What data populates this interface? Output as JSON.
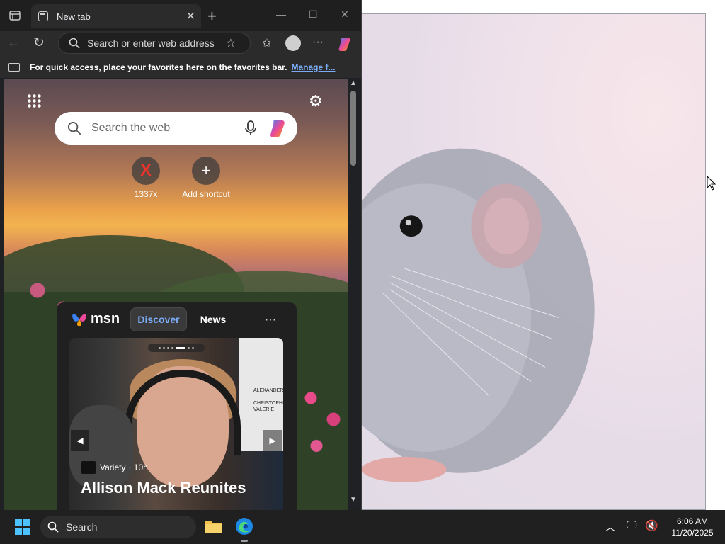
{
  "browser": {
    "tab_title": "New tab",
    "address_placeholder": "Search or enter web address",
    "favorites_message": "For quick access, place your favorites here on the favorites bar.",
    "favorites_link": "Manage f...",
    "more_label": "···"
  },
  "ntp": {
    "search_placeholder": "Search the web",
    "shortcuts": [
      {
        "label": "1337x"
      },
      {
        "label": "Add shortcut"
      }
    ]
  },
  "msn": {
    "brand": "msn",
    "tabs": [
      "Discover",
      "News"
    ],
    "more": "···",
    "article": {
      "source": "Variety",
      "age": "· 10h",
      "headline": "Allison Mack Reunites"
    }
  },
  "taskbar": {
    "search_label": "Search",
    "time": "6:06 AM",
    "date": "11/20/2025"
  },
  "colors": {
    "accent": "#7cacf8",
    "copilot_gradient": [
      "#3b82f6",
      "#ec4899",
      "#f59e0b"
    ]
  }
}
